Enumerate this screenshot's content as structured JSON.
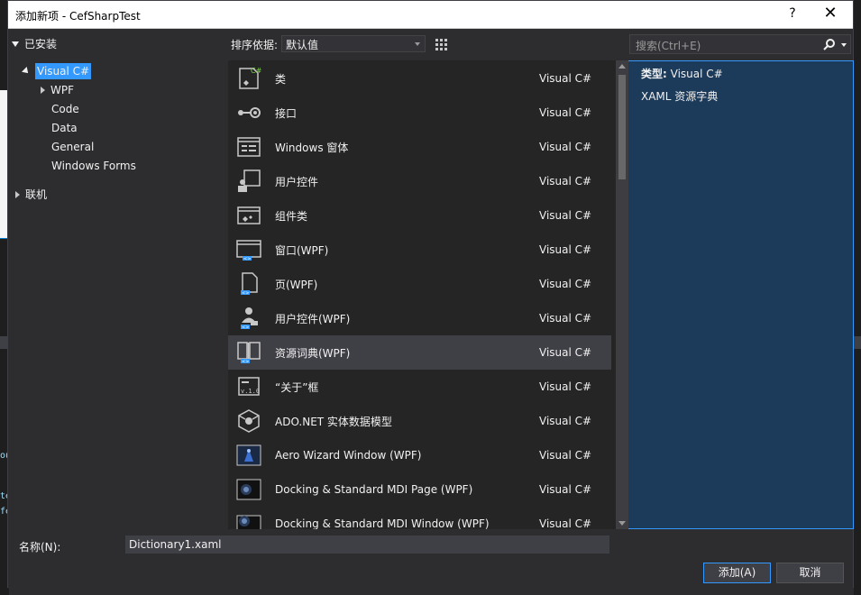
{
  "window": {
    "title": "添加新项 - CefSharpTest",
    "help_label": "?",
    "close_label": "✕"
  },
  "left_panel": {
    "installed_label": "已安装",
    "tree": [
      {
        "label": "Visual C#",
        "selected": true
      },
      {
        "label": "WPF"
      },
      {
        "label": "Code"
      },
      {
        "label": "Data"
      },
      {
        "label": "General"
      },
      {
        "label": "Windows Forms"
      }
    ],
    "online_label": "联机"
  },
  "toolbar": {
    "sort_label": "排序依据:",
    "sort_value": "默认值",
    "search_placeholder": "搜索(Ctrl+E)"
  },
  "templates": [
    {
      "name": "类",
      "lang": "Visual C#",
      "icon": "class-icon"
    },
    {
      "name": "接口",
      "lang": "Visual C#",
      "icon": "interface-icon"
    },
    {
      "name": "Windows 窗体",
      "lang": "Visual C#",
      "icon": "windows-form-icon"
    },
    {
      "name": "用户控件",
      "lang": "Visual C#",
      "icon": "user-control-icon"
    },
    {
      "name": "组件类",
      "lang": "Visual C#",
      "icon": "component-class-icon"
    },
    {
      "name": "窗口(WPF)",
      "lang": "Visual C#",
      "icon": "wpf-window-icon"
    },
    {
      "name": "页(WPF)",
      "lang": "Visual C#",
      "icon": "wpf-page-icon"
    },
    {
      "name": "用户控件(WPF)",
      "lang": "Visual C#",
      "icon": "wpf-user-control-icon"
    },
    {
      "name": "资源词典(WPF)",
      "lang": "Visual C#",
      "icon": "resource-dictionary-icon",
      "selected": true
    },
    {
      "name": "“关于”框",
      "lang": "Visual C#",
      "icon": "about-box-icon"
    },
    {
      "name": "ADO.NET 实体数据模型",
      "lang": "Visual C#",
      "icon": "ado-entity-model-icon"
    },
    {
      "name": "Aero Wizard Window (WPF)",
      "lang": "Visual C#",
      "icon": "aero-wizard-icon"
    },
    {
      "name": "Docking & Standard MDI Page (WPF)",
      "lang": "Visual C#",
      "icon": "docking-page-icon"
    },
    {
      "name": "Docking & Standard MDI Window (WPF)",
      "lang": "Visual C#",
      "icon": "docking-window-icon"
    }
  ],
  "details": {
    "type_label": "类型:",
    "type_value": "Visual C#",
    "description": "XAML 资源字典"
  },
  "bottom": {
    "name_label": "名称(N):",
    "name_value": "Dictionary1.xaml",
    "add_label": "添加(A)",
    "cancel_label": "取消"
  },
  "bg_code_fragments": [
    "ou",
    "te",
    "fe"
  ],
  "colors": {
    "accent": "#3399ff",
    "dialog_bg": "#2d2d30",
    "list_bg": "#252526",
    "selected_row": "#3f3f46"
  }
}
